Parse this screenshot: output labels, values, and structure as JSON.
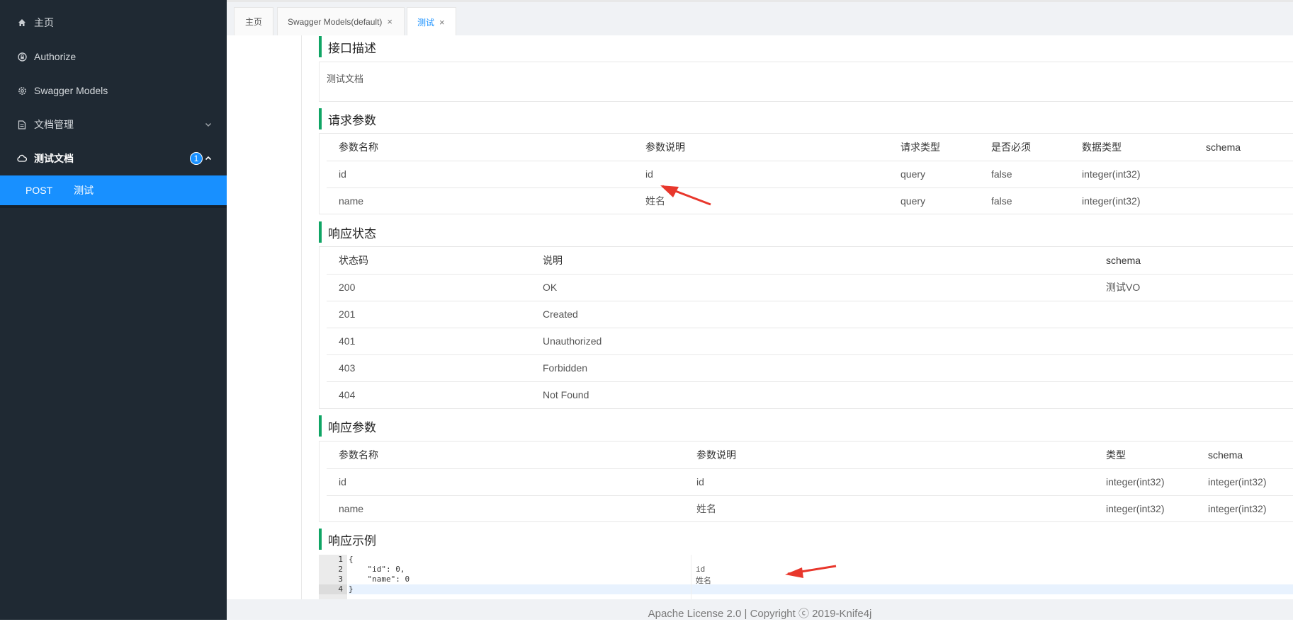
{
  "sidebar": {
    "items": [
      {
        "label": "主页",
        "icon": "home-icon"
      },
      {
        "label": "Authorize",
        "icon": "lock-icon"
      },
      {
        "label": "Swagger Models",
        "icon": "gear-icon"
      },
      {
        "label": "文档管理",
        "icon": "document-icon"
      },
      {
        "label": "测试文档",
        "icon": "cloud-icon",
        "badge": "1"
      }
    ],
    "submenu": {
      "method": "POST",
      "label": "测试"
    }
  },
  "tabs": [
    {
      "label": "主页"
    },
    {
      "label": "Swagger Models(default)",
      "close": "×"
    },
    {
      "label": "测试",
      "close": "×"
    }
  ],
  "sections": {
    "description": {
      "title": "接口描述",
      "text": "测试文档"
    },
    "request_params": {
      "title": "请求参数",
      "headers": [
        "参数名称",
        "参数说明",
        "请求类型",
        "是否必须",
        "数据类型",
        "schema"
      ],
      "rows": [
        [
          "id",
          "id",
          "query",
          "false",
          "integer(int32)",
          ""
        ],
        [
          "name",
          "姓名",
          "query",
          "false",
          "integer(int32)",
          ""
        ]
      ]
    },
    "response_status": {
      "title": "响应状态",
      "headers": [
        "状态码",
        "说明",
        "schema"
      ],
      "rows": [
        [
          "200",
          "OK",
          "测试VO"
        ],
        [
          "201",
          "Created",
          ""
        ],
        [
          "401",
          "Unauthorized",
          ""
        ],
        [
          "403",
          "Forbidden",
          ""
        ],
        [
          "404",
          "Not Found",
          ""
        ]
      ]
    },
    "response_params": {
      "title": "响应参数",
      "headers": [
        "参数名称",
        "参数说明",
        "类型",
        "schema"
      ],
      "rows": [
        [
          "id",
          "id",
          "integer(int32)",
          "integer(int32)"
        ],
        [
          "name",
          "姓名",
          "integer(int32)",
          "integer(int32)"
        ]
      ]
    },
    "response_example": {
      "title": "响应示例",
      "line_numbers": [
        "1",
        "2",
        "3",
        "4"
      ],
      "lines": [
        "{",
        "    \"id\": 0,",
        "    \"name\": 0",
        "}"
      ],
      "comments": [
        "id",
        "姓名"
      ]
    }
  },
  "footer": {
    "text": "Apache License 2.0 | Copyright ⓒ 2019-Knife4j"
  },
  "colors": {
    "accent": "#1890ff",
    "sidebar_bg": "#1f2933",
    "section_bar": "#10a565",
    "arrow": "#e8372c"
  }
}
